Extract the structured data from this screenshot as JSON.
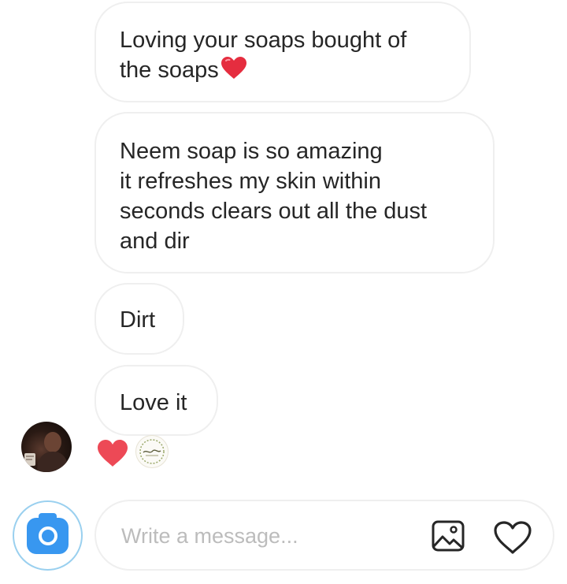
{
  "messages": [
    {
      "text": "Loving your soaps bought of\nthe soaps",
      "emoji": "red-heart-icon"
    },
    {
      "text": "Neem soap is so amazing\nit refreshes my skin within\nseconds clears out all the dust\nand dir"
    },
    {
      "text": "Dirt"
    },
    {
      "text": "Love it"
    }
  ],
  "reactions": {
    "heart": {
      "icon": "red-heart-icon",
      "color": "#ed4956"
    },
    "sticker": {
      "icon": "sticker-icon"
    }
  },
  "composer": {
    "placeholder": "Write a message...",
    "camera_icon": "camera-icon",
    "gallery_icon": "image-gallery-icon",
    "like_icon": "heart-outline-icon"
  },
  "colors": {
    "accent": "#3897f0",
    "heart": "#ed4956",
    "bubble_border": "#efefef",
    "placeholder": "#bcbcbc",
    "text": "#262626"
  }
}
